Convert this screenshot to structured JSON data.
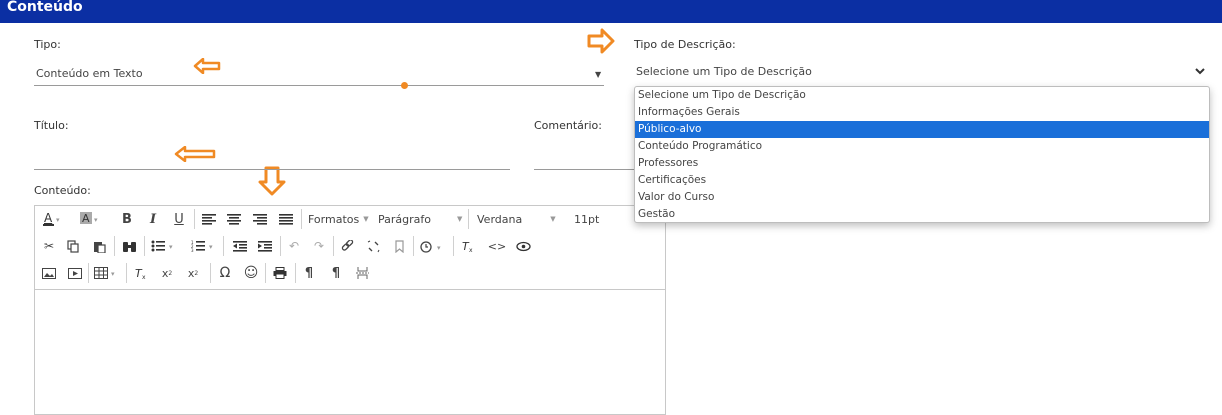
{
  "header": {
    "title": "Conteúdo"
  },
  "form": {
    "tipo_label": "Tipo:",
    "tipo_value": "Conteúdo em Texto",
    "tipo_descricao_label": "Tipo de Descrição:",
    "tipo_descricao_value": "Selecione um Tipo de Descrição",
    "titulo_label": "Título:",
    "comentario_label": "Comentário:",
    "conteudo_label": "Conteúdo:"
  },
  "dropdown": {
    "options": [
      "Selecione um Tipo de Descrição",
      "Informações Gerais",
      "Público-alvo",
      "Conteúdo Programático",
      "Professores",
      "Certificações",
      "Valor do Curso",
      "Gestão"
    ],
    "highlighted": "Público-alvo"
  },
  "editor": {
    "formats_label": "Formatos",
    "paragraph_label": "Parágrafo",
    "font_label": "Verdana",
    "size_label": "11pt"
  },
  "colors": {
    "header": "#0b2fa3",
    "accent": "#f08a24",
    "selected": "#1a6fd9"
  }
}
